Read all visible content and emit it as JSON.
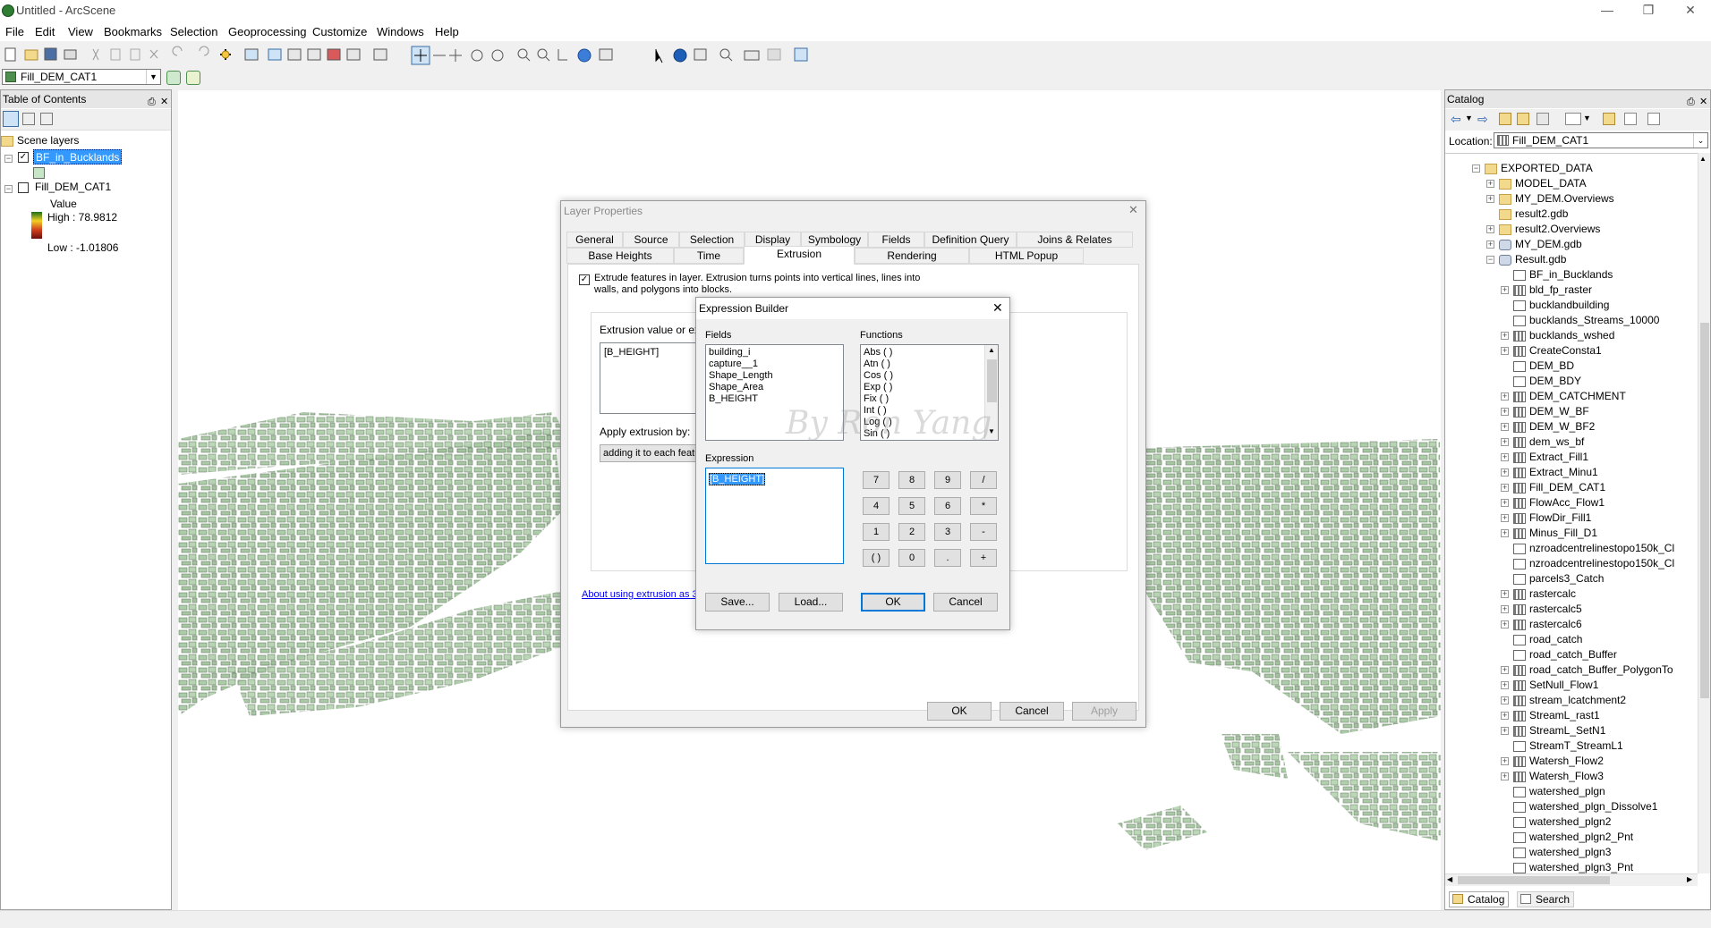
{
  "window": {
    "title": "Untitled - ArcScene"
  },
  "menu": [
    "File",
    "Edit",
    "View",
    "Bookmarks",
    "Selection",
    "Geoprocessing",
    "Customize",
    "Windows",
    "Help"
  ],
  "layer_combo": {
    "value": "Fill_DEM_CAT1"
  },
  "toc": {
    "title": "Table of Contents",
    "group": "Scene layers",
    "layer1": "BF_in_Bucklands",
    "layer2": "Fill_DEM_CAT1",
    "value_label": "Value",
    "high": "High : 78.9812",
    "low": "Low : -1.01806"
  },
  "catalog": {
    "title": "Catalog",
    "location_label": "Location:",
    "location_value": "Fill_DEM_CAT1",
    "items": [
      {
        "label": "EXPORTED_DATA",
        "icon": "folder",
        "level": 0,
        "exp": "-"
      },
      {
        "label": "MODEL_DATA",
        "icon": "folder",
        "level": 1,
        "exp": "+"
      },
      {
        "label": "MY_DEM.Overviews",
        "icon": "folder",
        "level": 1,
        "exp": "+"
      },
      {
        "label": "result2.gdb",
        "icon": "folder",
        "level": 1,
        "exp": ""
      },
      {
        "label": "result2.Overviews",
        "icon": "folder",
        "level": 1,
        "exp": "+"
      },
      {
        "label": "MY_DEM.gdb",
        "icon": "gdb",
        "level": 1,
        "exp": "+"
      },
      {
        "label": "Result.gdb",
        "icon": "gdb",
        "level": 1,
        "exp": "-"
      },
      {
        "label": "BF_in_Bucklands",
        "icon": "poly",
        "level": 2,
        "exp": ""
      },
      {
        "label": "bld_fp_raster",
        "icon": "raster",
        "level": 2,
        "exp": "+"
      },
      {
        "label": "bucklandbuilding",
        "icon": "poly",
        "level": 2,
        "exp": ""
      },
      {
        "label": "bucklands_Streams_10000",
        "icon": "poly",
        "level": 2,
        "exp": ""
      },
      {
        "label": "bucklands_wshed",
        "icon": "raster",
        "level": 2,
        "exp": "+"
      },
      {
        "label": "CreateConsta1",
        "icon": "raster",
        "level": 2,
        "exp": "+"
      },
      {
        "label": "DEM_BD",
        "icon": "poly",
        "level": 2,
        "exp": ""
      },
      {
        "label": "DEM_BDY",
        "icon": "poly",
        "level": 2,
        "exp": ""
      },
      {
        "label": "DEM_CATCHMENT",
        "icon": "raster",
        "level": 2,
        "exp": "+"
      },
      {
        "label": "DEM_W_BF",
        "icon": "raster",
        "level": 2,
        "exp": "+"
      },
      {
        "label": "DEM_W_BF2",
        "icon": "raster",
        "level": 2,
        "exp": "+"
      },
      {
        "label": "dem_ws_bf",
        "icon": "raster",
        "level": 2,
        "exp": "+"
      },
      {
        "label": "Extract_Fill1",
        "icon": "raster",
        "level": 2,
        "exp": "+"
      },
      {
        "label": "Extract_Minu1",
        "icon": "raster",
        "level": 2,
        "exp": "+"
      },
      {
        "label": "Fill_DEM_CAT1",
        "icon": "raster",
        "level": 2,
        "exp": "+"
      },
      {
        "label": "FlowAcc_Flow1",
        "icon": "raster",
        "level": 2,
        "exp": "+"
      },
      {
        "label": "FlowDir_Fill1",
        "icon": "raster",
        "level": 2,
        "exp": "+"
      },
      {
        "label": "Minus_Fill_D1",
        "icon": "raster",
        "level": 2,
        "exp": "+"
      },
      {
        "label": "nzroadcentrelinestopo150k_Cl",
        "icon": "poly",
        "level": 2,
        "exp": ""
      },
      {
        "label": "nzroadcentrelinestopo150k_Cl",
        "icon": "poly",
        "level": 2,
        "exp": ""
      },
      {
        "label": "parcels3_Catch",
        "icon": "poly",
        "level": 2,
        "exp": ""
      },
      {
        "label": "rastercalc",
        "icon": "raster",
        "level": 2,
        "exp": "+"
      },
      {
        "label": "rastercalc5",
        "icon": "raster",
        "level": 2,
        "exp": "+"
      },
      {
        "label": "rastercalc6",
        "icon": "raster",
        "level": 2,
        "exp": "+"
      },
      {
        "label": "road_catch",
        "icon": "poly",
        "level": 2,
        "exp": ""
      },
      {
        "label": "road_catch_Buffer",
        "icon": "poly",
        "level": 2,
        "exp": ""
      },
      {
        "label": "road_catch_Buffer_PolygonTo",
        "icon": "raster",
        "level": 2,
        "exp": "+"
      },
      {
        "label": "SetNull_Flow1",
        "icon": "raster",
        "level": 2,
        "exp": "+"
      },
      {
        "label": "stream_lcatchment2",
        "icon": "raster",
        "level": 2,
        "exp": "+"
      },
      {
        "label": "StreamL_rast1",
        "icon": "raster",
        "level": 2,
        "exp": "+"
      },
      {
        "label": "StreamL_SetN1",
        "icon": "raster",
        "level": 2,
        "exp": "+"
      },
      {
        "label": "StreamT_StreamL1",
        "icon": "poly",
        "level": 2,
        "exp": ""
      },
      {
        "label": "Watersh_Flow2",
        "icon": "raster",
        "level": 2,
        "exp": "+"
      },
      {
        "label": "Watersh_Flow3",
        "icon": "raster",
        "level": 2,
        "exp": "+"
      },
      {
        "label": "watershed_plgn",
        "icon": "poly",
        "level": 2,
        "exp": ""
      },
      {
        "label": "watershed_plgn_Dissolve1",
        "icon": "poly",
        "level": 2,
        "exp": ""
      },
      {
        "label": "watershed_plgn2",
        "icon": "poly",
        "level": 2,
        "exp": ""
      },
      {
        "label": "watershed_plgn2_Pnt",
        "icon": "pt",
        "level": 2,
        "exp": ""
      },
      {
        "label": "watershed_plgn3",
        "icon": "poly",
        "level": 2,
        "exp": ""
      },
      {
        "label": "watershed_plgn3_Pnt",
        "icon": "pt",
        "level": 2,
        "exp": ""
      }
    ],
    "tab_catalog": "Catalog",
    "tab_search": "Search"
  },
  "layer_props": {
    "title": "Layer Properties",
    "tabs_row1": [
      "General",
      "Source",
      "Selection",
      "Display",
      "Symbology",
      "Fields",
      "Definition Query",
      "Joins & Relates"
    ],
    "tabs_row2": [
      "Base Heights",
      "Time",
      "Extrusion",
      "Rendering",
      "HTML Popup"
    ],
    "active_tab": "Extrusion",
    "check_text_1": "Extrude features in layer.  Extrusion turns points into vertical lines, lines into",
    "check_text_2": "walls, and polygons into blocks.",
    "extrusion_label": "Extrusion value or expr",
    "extrusion_value": "[B_HEIGHT]",
    "apply_label": "Apply extrusion by:",
    "apply_value": "adding it to each featu",
    "link": "About using extrusion as 3D",
    "ok": "OK",
    "cancel": "Cancel",
    "apply": "Apply"
  },
  "expr_builder": {
    "title": "Expression Builder",
    "fields_label": "Fields",
    "fields": [
      "building_i",
      "capture__1",
      "Shape_Length",
      "Shape_Area",
      "B_HEIGHT"
    ],
    "functions_label": "Functions",
    "functions": [
      "Abs ( )",
      "Atn ( )",
      "Cos ( )",
      "Exp ( )",
      "Fix ( )",
      "Int ( )",
      "Log ( )",
      "Sin ( )"
    ],
    "expression_label": "Expression",
    "expression": "[B_HEIGHT]",
    "keys": [
      "7",
      "8",
      "9",
      "/",
      "4",
      "5",
      "6",
      "*",
      "1",
      "2",
      "3",
      "-",
      "( )",
      "0",
      ".",
      "+"
    ],
    "save": "Save...",
    "load": "Load...",
    "ok": "OK",
    "cancel": "Cancel",
    "watermark": "By Ron Yang"
  }
}
